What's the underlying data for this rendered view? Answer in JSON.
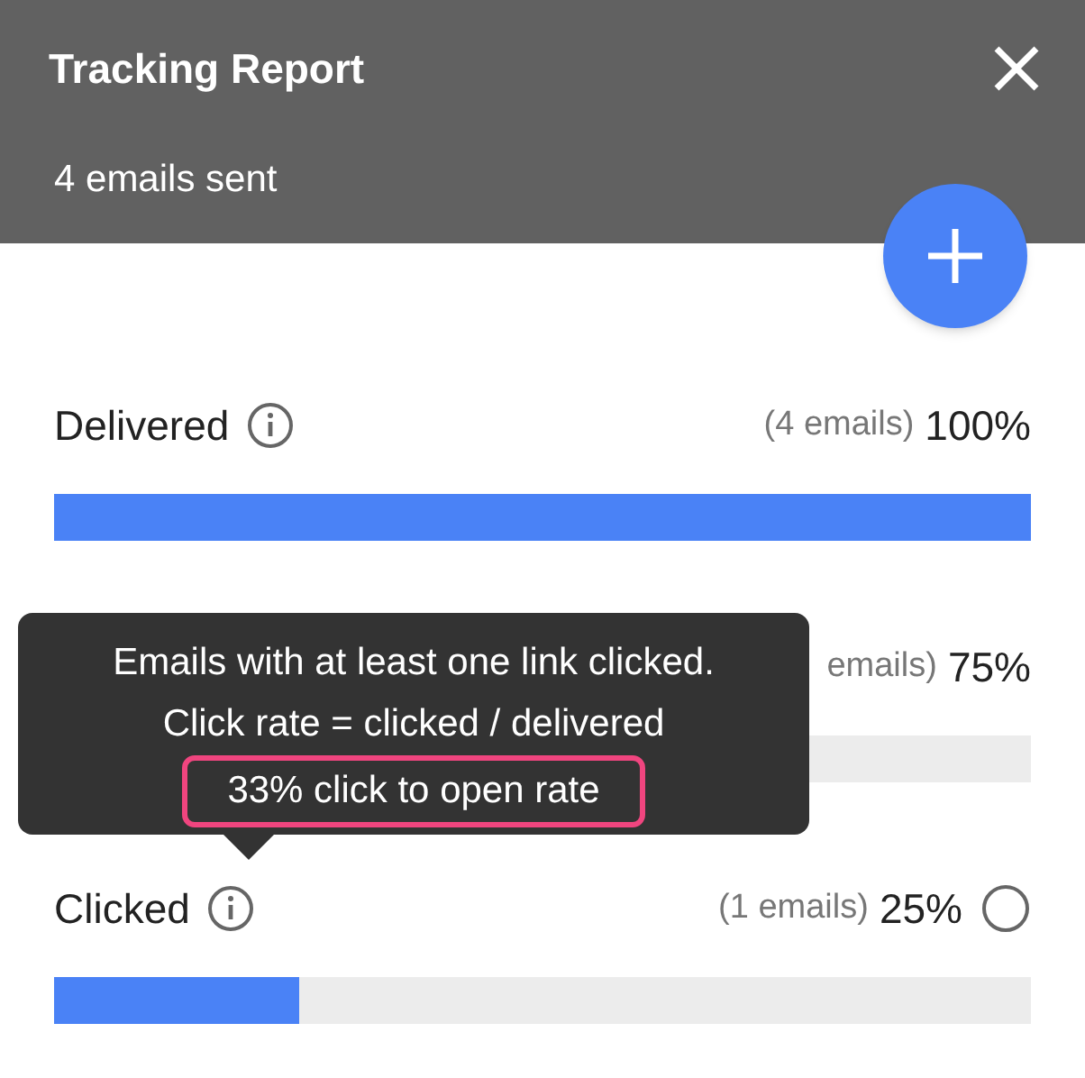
{
  "header": {
    "title": "Tracking Report",
    "subtitle": "4 emails sent"
  },
  "rows": [
    {
      "label": "Delivered",
      "count": "(4 emails)",
      "percent": "100%",
      "level": 1,
      "info": true,
      "circle": false
    },
    {
      "count": "emails)",
      "percent": "75%",
      "info": false,
      "circle": false
    },
    {
      "label": "Clicked",
      "count": "(1 emails)",
      "percent": "25%",
      "level": 0.25,
      "info": true,
      "circle": true
    }
  ],
  "tooltip": {
    "lines": [
      "Emails with at least one link clicked.",
      "Click rate = clicked / delivered"
    ],
    "highlight": "33% click to open rate"
  }
}
